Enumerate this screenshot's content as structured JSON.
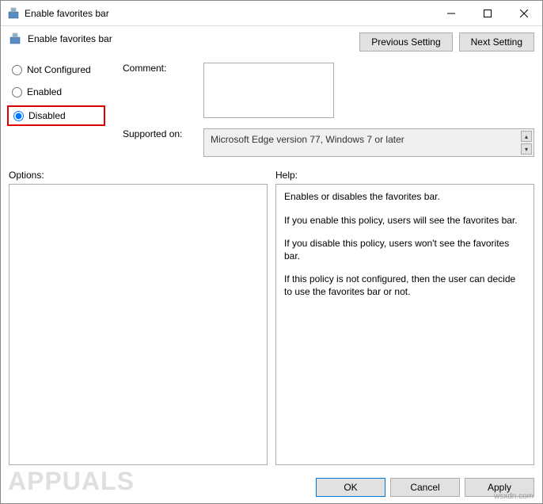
{
  "window": {
    "title": "Enable favorites bar"
  },
  "header": {
    "title": "Enable favorites bar"
  },
  "nav": {
    "previous": "Previous Setting",
    "next": "Next Setting"
  },
  "radios": {
    "not_configured": "Not Configured",
    "enabled": "Enabled",
    "disabled": "Disabled",
    "selected": "disabled"
  },
  "fields": {
    "comment_label": "Comment:",
    "comment_value": "",
    "supported_label": "Supported on:",
    "supported_value": "Microsoft Edge version 77, Windows 7 or later"
  },
  "panels": {
    "options_label": "Options:",
    "help_label": "Help:",
    "help_paragraphs": [
      "Enables or disables the favorites bar.",
      "If you enable this policy, users will see the favorites bar.",
      "If you disable this policy, users won't see the favorites bar.",
      "If this policy is not configured, then the user can decide to use the favorites bar or not."
    ]
  },
  "footer": {
    "ok": "OK",
    "cancel": "Cancel",
    "apply": "Apply"
  },
  "watermark": {
    "brand": "APPUALS",
    "source": "wsxdn.com"
  }
}
